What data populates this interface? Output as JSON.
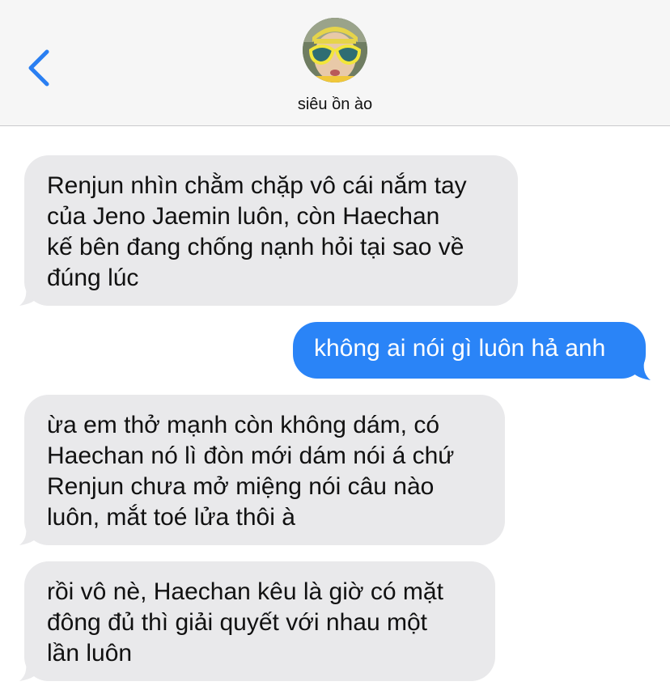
{
  "header": {
    "contact_name": "siêu ồn ào",
    "back_icon": "chevron-left-icon",
    "accent_color": "#2a7ff2"
  },
  "messages": [
    {
      "direction": "incoming",
      "text": "Renjun nhìn chằm chặp vô cái nắm tay\ncủa Jeno Jaemin luôn, còn Haechan\nkế bên đang chống nạnh hỏi tại sao về\nđúng lúc"
    },
    {
      "direction": "outgoing",
      "text": "không ai nói gì luôn hả anh"
    },
    {
      "direction": "incoming",
      "text": "ừa em thở mạnh còn không dám, có\nHaechan nó lì đòn mới dám nói á chứ\nRenjun chưa mở miệng nói câu nào\nluôn, mắt toé lửa thôi à"
    },
    {
      "direction": "incoming",
      "text": "rồi vô nè, Haechan kêu là giờ có mặt\nđông đủ thì giải quyết với nhau một\nlần luôn"
    }
  ],
  "colors": {
    "incoming_bubble": "#e9e9eb",
    "outgoing_bubble": "#2a84f7",
    "header_bg": "#f6f6f6"
  }
}
